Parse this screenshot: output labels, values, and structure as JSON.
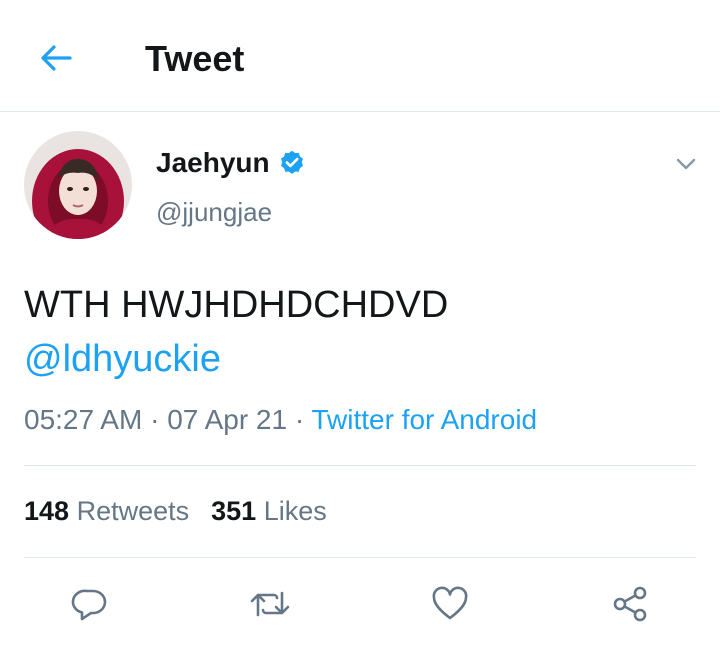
{
  "header": {
    "title": "Tweet"
  },
  "tweet": {
    "author_name": "Jaehyun",
    "author_handle": "@jjungjae",
    "text_line": "WTH HWJHDHDCHDVD",
    "mention": "@ldhyuckie",
    "time": "05:27 AM",
    "date": "07 Apr 21",
    "sep": "·",
    "source": "Twitter for Android"
  },
  "stats": {
    "retweets_count": "148",
    "retweets_label": "Retweets",
    "likes_count": "351",
    "likes_label": "Likes"
  },
  "colors": {
    "accent": "#1da1f2",
    "verified": "#1da1f2",
    "muted": "#657786",
    "avatar_hood": "#a8123a"
  },
  "icons": [
    "back-arrow-icon",
    "verified-badge-icon",
    "chevron-down-icon",
    "reply-icon",
    "retweet-icon",
    "like-icon",
    "share-icon"
  ]
}
